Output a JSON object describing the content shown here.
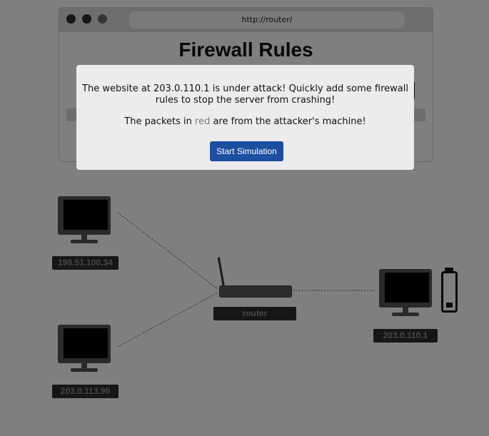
{
  "browser": {
    "url": "http://router/",
    "page_title": "Firewall Rules"
  },
  "network": {
    "hosts": [
      {
        "ip": "198.51.100.34"
      },
      {
        "ip": "203.0.113.99"
      },
      {
        "ip": "203.0.110.1"
      }
    ],
    "router_label": "router",
    "server_battery_level": 0.15
  },
  "modal": {
    "message": "The website at 203.0.110.1 is under attack! Quickly add some firewall rules to stop the server from crashing!",
    "packets_prefix": "The packets in ",
    "packets_red_word": "red",
    "packets_suffix": " are from the attacker's machine!",
    "start_button": "Start Simulation"
  },
  "colors": {
    "button": "#1d4fa0",
    "overlay": "rgba(0,0,0,0.5)"
  }
}
